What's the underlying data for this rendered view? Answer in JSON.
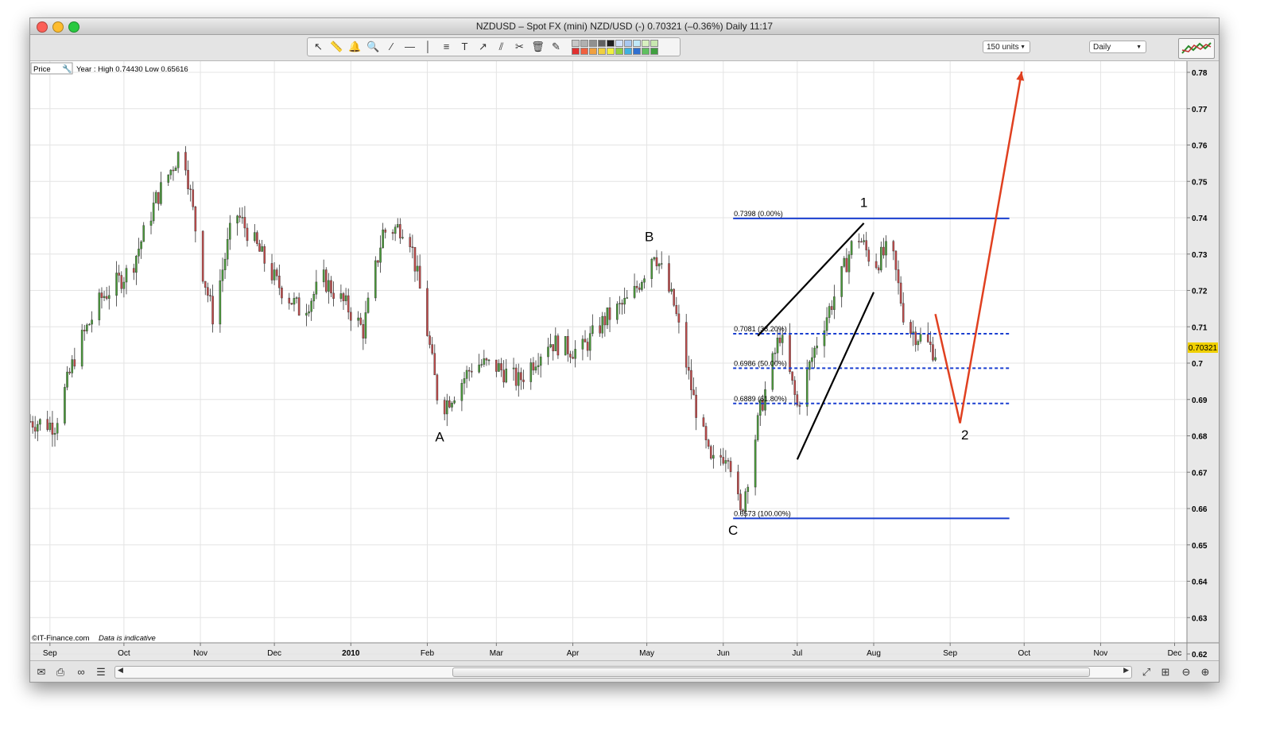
{
  "window": {
    "title": "NZDUSD – Spot FX (mini) NZD/USD (-)     0.70321 (–0.36%)     Daily   11:17"
  },
  "toolbar": {
    "units_label": "150 units",
    "period_label": "Daily",
    "tools": [
      "pointer-icon",
      "ruler-icon",
      "alarm-bell-icon",
      "zoom-tool-icon",
      "trendline-icon",
      "horizontal-line-icon",
      "vertical-line-icon",
      "fibonacci-icon",
      "text-icon",
      "ray-icon",
      "channel-icon",
      "tools-icon",
      "trash-icon",
      "pen-icon"
    ],
    "swatch_colors": [
      "#c8c8c8",
      "#b0b0b0",
      "#909090",
      "#606060",
      "#202020",
      "#d0e0f8",
      "#a8c8f0",
      "#c0e8f8",
      "#d8f0c0",
      "#c8e8b0",
      "#e03030",
      "#f06040",
      "#f0a040",
      "#f0d040",
      "#f0f040",
      "#90d040",
      "#40b0e0",
      "#3070d0",
      "#60c060",
      "#40a040"
    ]
  },
  "chart_data": {
    "type": "candlestick",
    "legend": {
      "price_label": "Price",
      "info": "Year : High 0.74430 Low 0.65616"
    },
    "footer": {
      "copyright": "©IT-Finance.com",
      "note": "Data is indicative"
    },
    "current_price_label": "0.70321",
    "ylim": [
      0.62,
      0.78
    ],
    "yticks": [
      "0.78",
      "0.77",
      "0.76",
      "0.75",
      "0.74",
      "0.73",
      "0.72",
      "0.71",
      "0.7",
      "0.69",
      "0.68",
      "0.67",
      "0.66",
      "0.65",
      "0.64",
      "0.63",
      "0.62"
    ],
    "xlim": [
      "2009-08-24",
      "2010-12-06"
    ],
    "xticks": [
      {
        "label": "Sep",
        "date": "2009-09-01"
      },
      {
        "label": "Oct",
        "date": "2009-10-01"
      },
      {
        "label": "Nov",
        "date": "2009-11-01"
      },
      {
        "label": "Dec",
        "date": "2009-12-01"
      },
      {
        "label": "2010",
        "date": "2010-01-01"
      },
      {
        "label": "Feb",
        "date": "2010-02-01"
      },
      {
        "label": "Mar",
        "date": "2010-03-01"
      },
      {
        "label": "Apr",
        "date": "2010-04-01"
      },
      {
        "label": "May",
        "date": "2010-05-01"
      },
      {
        "label": "Jun",
        "date": "2010-06-01"
      },
      {
        "label": "Jul",
        "date": "2010-07-01"
      },
      {
        "label": "Aug",
        "date": "2010-08-01"
      },
      {
        "label": "Sep",
        "date": "2010-09-01"
      },
      {
        "label": "Oct",
        "date": "2010-10-01"
      },
      {
        "label": "Nov",
        "date": "2010-11-01"
      },
      {
        "label": "Dec",
        "date": "2010-12-01"
      }
    ],
    "price_path": [
      [
        "2009-08-24",
        0.684
      ],
      [
        "2009-09-03",
        0.683
      ],
      [
        "2009-09-12",
        0.704
      ],
      [
        "2009-09-22",
        0.718
      ],
      [
        "2009-10-04",
        0.726
      ],
      [
        "2009-10-14",
        0.745
      ],
      [
        "2009-10-25",
        0.76
      ],
      [
        "2009-11-01",
        0.728
      ],
      [
        "2009-11-06",
        0.713
      ],
      [
        "2009-11-15",
        0.742
      ],
      [
        "2009-11-23",
        0.733
      ],
      [
        "2009-12-02",
        0.722
      ],
      [
        "2009-12-12",
        0.714
      ],
      [
        "2009-12-21",
        0.723
      ],
      [
        "2009-12-31",
        0.715
      ],
      [
        "2010-01-06",
        0.709
      ],
      [
        "2010-01-14",
        0.736
      ],
      [
        "2010-01-24",
        0.738
      ],
      [
        "2010-01-31",
        0.713
      ],
      [
        "2010-02-06",
        0.687
      ],
      [
        "2010-02-12",
        0.692
      ],
      [
        "2010-02-20",
        0.7
      ],
      [
        "2010-03-01",
        0.699
      ],
      [
        "2010-03-10",
        0.695
      ],
      [
        "2010-03-22",
        0.706
      ],
      [
        "2010-04-04",
        0.703
      ],
      [
        "2010-04-14",
        0.712
      ],
      [
        "2010-04-25",
        0.718
      ],
      [
        "2010-05-04",
        0.731
      ],
      [
        "2010-05-12",
        0.716
      ],
      [
        "2010-05-20",
        0.69
      ],
      [
        "2010-05-27",
        0.672
      ],
      [
        "2010-06-03",
        0.676
      ],
      [
        "2010-06-08",
        0.658
      ],
      [
        "2010-06-16",
        0.687
      ],
      [
        "2010-06-24",
        0.708
      ],
      [
        "2010-07-01",
        0.688
      ],
      [
        "2010-07-09",
        0.706
      ],
      [
        "2010-07-18",
        0.722
      ],
      [
        "2010-07-25",
        0.736
      ],
      [
        "2010-08-01",
        0.727
      ],
      [
        "2010-08-08",
        0.732
      ],
      [
        "2010-08-14",
        0.71
      ],
      [
        "2010-08-20",
        0.707
      ],
      [
        "2010-08-26",
        0.703
      ]
    ],
    "fibonacci": {
      "start_date": "2010-06-05",
      "end_date": "2010-09-25",
      "levels": [
        {
          "price": 0.7398,
          "label": "0.7398 (0.00%)",
          "style": "solid"
        },
        {
          "price": 0.7081,
          "label": "0.7081 (38.20%)",
          "style": "dotted"
        },
        {
          "price": 0.6986,
          "label": "0.6986 (50.00%)",
          "style": "dotted"
        },
        {
          "price": 0.6889,
          "label": "0.6889 (61.80%)",
          "style": "dotted"
        },
        {
          "price": 0.6573,
          "label": "0.6573 (100.00%)",
          "style": "solid"
        }
      ]
    },
    "wedge_lines": [
      {
        "from": [
          "2010-06-15",
          0.7075
        ],
        "to": [
          "2010-07-28",
          0.7385
        ]
      },
      {
        "from": [
          "2010-07-01",
          0.6735
        ],
        "to": [
          "2010-08-01",
          0.7195
        ]
      }
    ],
    "projection": [
      [
        "2010-08-26",
        0.7135
      ],
      [
        "2010-09-05",
        0.6835
      ],
      [
        "2010-09-30",
        0.7802
      ]
    ],
    "wave_labels": [
      {
        "text": "A",
        "date": "2010-02-06",
        "price": 0.6785
      },
      {
        "text": "B",
        "date": "2010-05-02",
        "price": 0.7335
      },
      {
        "text": "C",
        "date": "2010-06-05",
        "price": 0.6528
      },
      {
        "text": "1",
        "date": "2010-07-28",
        "price": 0.743
      },
      {
        "text": "2",
        "date": "2010-09-07",
        "price": 0.679
      }
    ],
    "colors": {
      "bull": "#4a9a3a",
      "bear": "#c04a4a",
      "fib": "#1a3fd0",
      "projection": "#e04020",
      "wedge": "#000000",
      "price_tag": "#f0d000"
    }
  }
}
